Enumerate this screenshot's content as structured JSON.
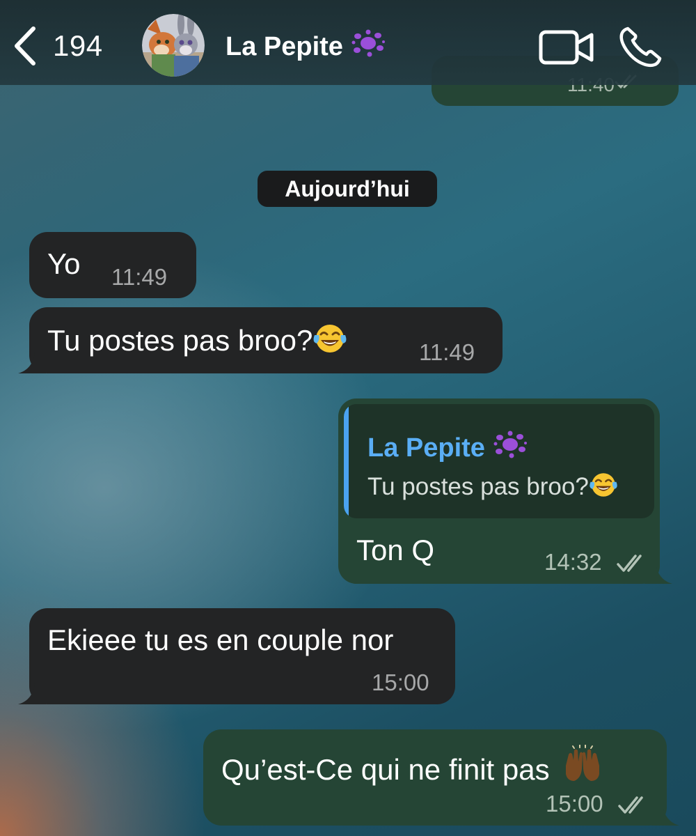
{
  "header": {
    "back_count": "194",
    "contact_name": "La Pepite",
    "name_icon": "purple-splat-icon",
    "icons": [
      "chevron-left-icon",
      "video-camera-icon",
      "phone-icon"
    ]
  },
  "previous_message": {
    "time": "11:40",
    "status_icon": "double-check-icon"
  },
  "date_separator": "Aujourd’hui",
  "messages": [
    {
      "direction": "incoming",
      "text": "Yo",
      "time": "11:49"
    },
    {
      "direction": "incoming",
      "text": "Tu postes pas broo?",
      "emoji": "face-with-tears-of-joy-emoji",
      "time": "11:49"
    },
    {
      "direction": "outgoing",
      "reply_to": {
        "author": "La Pepite",
        "text": "Tu postes pas broo?",
        "emoji": "face-with-tears-of-joy-emoji"
      },
      "text": "Ton Q",
      "time": "14:32",
      "status_icon": "double-check-icon"
    },
    {
      "direction": "incoming",
      "text": "Ekieee tu es en couple nor",
      "time": "15:00"
    },
    {
      "direction": "outgoing",
      "text": "Qu’est-Ce qui ne finit pas",
      "emoji": "raising-hands-emoji",
      "time": "15:00",
      "status_icon": "double-check-icon"
    }
  ],
  "colors": {
    "incoming_bubble": "#232425",
    "outgoing_bubble": "#254535",
    "quote_accent": "#4aa3f0",
    "date_pill": "#1a1b1c"
  }
}
